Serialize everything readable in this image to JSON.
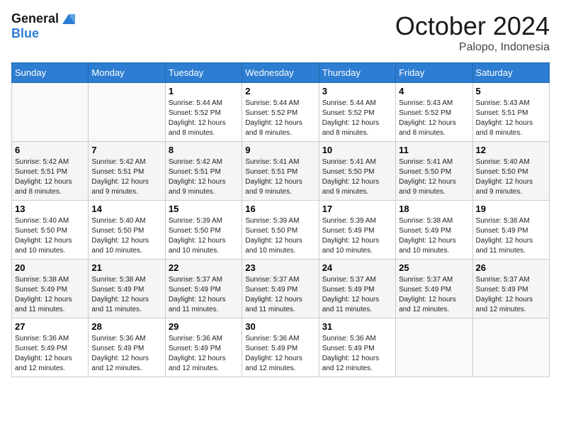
{
  "logo": {
    "line1": "General",
    "line2": "Blue"
  },
  "title": "October 2024",
  "location": "Palopo, Indonesia",
  "days_header": [
    "Sunday",
    "Monday",
    "Tuesday",
    "Wednesday",
    "Thursday",
    "Friday",
    "Saturday"
  ],
  "weeks": [
    [
      {
        "day": "",
        "sunrise": "",
        "sunset": "",
        "daylight": ""
      },
      {
        "day": "",
        "sunrise": "",
        "sunset": "",
        "daylight": ""
      },
      {
        "day": "1",
        "sunrise": "Sunrise: 5:44 AM",
        "sunset": "Sunset: 5:52 PM",
        "daylight": "Daylight: 12 hours and 8 minutes."
      },
      {
        "day": "2",
        "sunrise": "Sunrise: 5:44 AM",
        "sunset": "Sunset: 5:52 PM",
        "daylight": "Daylight: 12 hours and 8 minutes."
      },
      {
        "day": "3",
        "sunrise": "Sunrise: 5:44 AM",
        "sunset": "Sunset: 5:52 PM",
        "daylight": "Daylight: 12 hours and 8 minutes."
      },
      {
        "day": "4",
        "sunrise": "Sunrise: 5:43 AM",
        "sunset": "Sunset: 5:52 PM",
        "daylight": "Daylight: 12 hours and 8 minutes."
      },
      {
        "day": "5",
        "sunrise": "Sunrise: 5:43 AM",
        "sunset": "Sunset: 5:51 PM",
        "daylight": "Daylight: 12 hours and 8 minutes."
      }
    ],
    [
      {
        "day": "6",
        "sunrise": "Sunrise: 5:42 AM",
        "sunset": "Sunset: 5:51 PM",
        "daylight": "Daylight: 12 hours and 8 minutes."
      },
      {
        "day": "7",
        "sunrise": "Sunrise: 5:42 AM",
        "sunset": "Sunset: 5:51 PM",
        "daylight": "Daylight: 12 hours and 9 minutes."
      },
      {
        "day": "8",
        "sunrise": "Sunrise: 5:42 AM",
        "sunset": "Sunset: 5:51 PM",
        "daylight": "Daylight: 12 hours and 9 minutes."
      },
      {
        "day": "9",
        "sunrise": "Sunrise: 5:41 AM",
        "sunset": "Sunset: 5:51 PM",
        "daylight": "Daylight: 12 hours and 9 minutes."
      },
      {
        "day": "10",
        "sunrise": "Sunrise: 5:41 AM",
        "sunset": "Sunset: 5:50 PM",
        "daylight": "Daylight: 12 hours and 9 minutes."
      },
      {
        "day": "11",
        "sunrise": "Sunrise: 5:41 AM",
        "sunset": "Sunset: 5:50 PM",
        "daylight": "Daylight: 12 hours and 9 minutes."
      },
      {
        "day": "12",
        "sunrise": "Sunrise: 5:40 AM",
        "sunset": "Sunset: 5:50 PM",
        "daylight": "Daylight: 12 hours and 9 minutes."
      }
    ],
    [
      {
        "day": "13",
        "sunrise": "Sunrise: 5:40 AM",
        "sunset": "Sunset: 5:50 PM",
        "daylight": "Daylight: 12 hours and 10 minutes."
      },
      {
        "day": "14",
        "sunrise": "Sunrise: 5:40 AM",
        "sunset": "Sunset: 5:50 PM",
        "daylight": "Daylight: 12 hours and 10 minutes."
      },
      {
        "day": "15",
        "sunrise": "Sunrise: 5:39 AM",
        "sunset": "Sunset: 5:50 PM",
        "daylight": "Daylight: 12 hours and 10 minutes."
      },
      {
        "day": "16",
        "sunrise": "Sunrise: 5:39 AM",
        "sunset": "Sunset: 5:50 PM",
        "daylight": "Daylight: 12 hours and 10 minutes."
      },
      {
        "day": "17",
        "sunrise": "Sunrise: 5:39 AM",
        "sunset": "Sunset: 5:49 PM",
        "daylight": "Daylight: 12 hours and 10 minutes."
      },
      {
        "day": "18",
        "sunrise": "Sunrise: 5:38 AM",
        "sunset": "Sunset: 5:49 PM",
        "daylight": "Daylight: 12 hours and 10 minutes."
      },
      {
        "day": "19",
        "sunrise": "Sunrise: 5:38 AM",
        "sunset": "Sunset: 5:49 PM",
        "daylight": "Daylight: 12 hours and 11 minutes."
      }
    ],
    [
      {
        "day": "20",
        "sunrise": "Sunrise: 5:38 AM",
        "sunset": "Sunset: 5:49 PM",
        "daylight": "Daylight: 12 hours and 11 minutes."
      },
      {
        "day": "21",
        "sunrise": "Sunrise: 5:38 AM",
        "sunset": "Sunset: 5:49 PM",
        "daylight": "Daylight: 12 hours and 11 minutes."
      },
      {
        "day": "22",
        "sunrise": "Sunrise: 5:37 AM",
        "sunset": "Sunset: 5:49 PM",
        "daylight": "Daylight: 12 hours and 11 minutes."
      },
      {
        "day": "23",
        "sunrise": "Sunrise: 5:37 AM",
        "sunset": "Sunset: 5:49 PM",
        "daylight": "Daylight: 12 hours and 11 minutes."
      },
      {
        "day": "24",
        "sunrise": "Sunrise: 5:37 AM",
        "sunset": "Sunset: 5:49 PM",
        "daylight": "Daylight: 12 hours and 11 minutes."
      },
      {
        "day": "25",
        "sunrise": "Sunrise: 5:37 AM",
        "sunset": "Sunset: 5:49 PM",
        "daylight": "Daylight: 12 hours and 12 minutes."
      },
      {
        "day": "26",
        "sunrise": "Sunrise: 5:37 AM",
        "sunset": "Sunset: 5:49 PM",
        "daylight": "Daylight: 12 hours and 12 minutes."
      }
    ],
    [
      {
        "day": "27",
        "sunrise": "Sunrise: 5:36 AM",
        "sunset": "Sunset: 5:49 PM",
        "daylight": "Daylight: 12 hours and 12 minutes."
      },
      {
        "day": "28",
        "sunrise": "Sunrise: 5:36 AM",
        "sunset": "Sunset: 5:49 PM",
        "daylight": "Daylight: 12 hours and 12 minutes."
      },
      {
        "day": "29",
        "sunrise": "Sunrise: 5:36 AM",
        "sunset": "Sunset: 5:49 PM",
        "daylight": "Daylight: 12 hours and 12 minutes."
      },
      {
        "day": "30",
        "sunrise": "Sunrise: 5:36 AM",
        "sunset": "Sunset: 5:49 PM",
        "daylight": "Daylight: 12 hours and 12 minutes."
      },
      {
        "day": "31",
        "sunrise": "Sunrise: 5:36 AM",
        "sunset": "Sunset: 5:49 PM",
        "daylight": "Daylight: 12 hours and 12 minutes."
      },
      {
        "day": "",
        "sunrise": "",
        "sunset": "",
        "daylight": ""
      },
      {
        "day": "",
        "sunrise": "",
        "sunset": "",
        "daylight": ""
      }
    ]
  ]
}
